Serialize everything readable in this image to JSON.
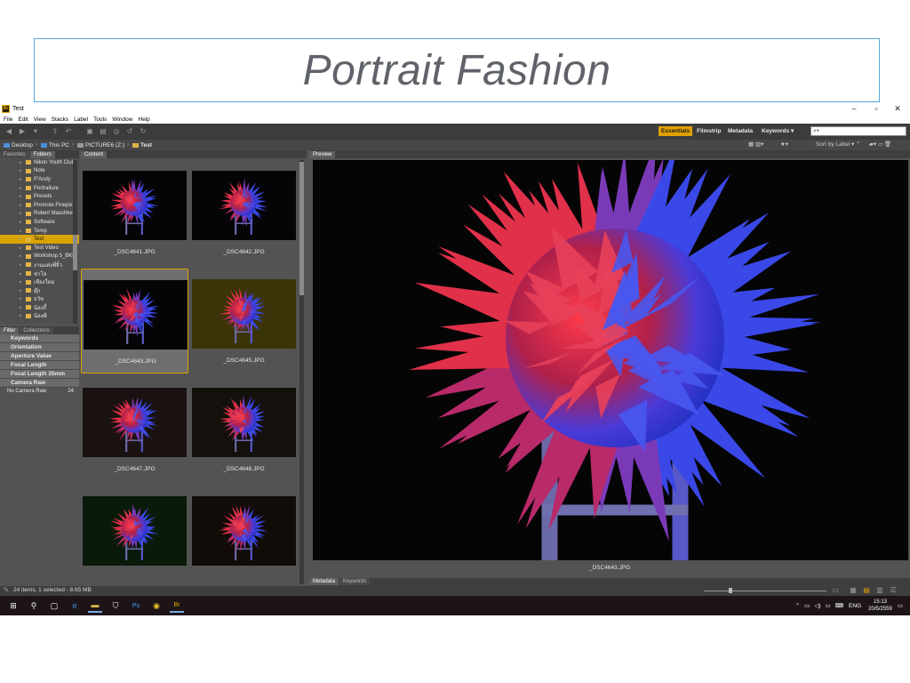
{
  "slide": {
    "title": "Portrait Fashion"
  },
  "window": {
    "title": "Test",
    "app_icon_text": "Br",
    "controls": {
      "minimize": "–",
      "maximize": "▫",
      "close": "✕"
    }
  },
  "menu": [
    "File",
    "Edit",
    "View",
    "Stacks",
    "Label",
    "Tools",
    "Window",
    "Help"
  ],
  "workspaces": {
    "items": [
      "Essentials",
      "Filmstrip",
      "Metadata",
      "Keywords"
    ],
    "active": "Essentials",
    "keywords_arrow": "▾",
    "search_placeholder": "⌕▾"
  },
  "path": {
    "crumbs": [
      "Desktop",
      "This PC",
      "PICTURE6 (Z:)",
      "Test"
    ],
    "sort_label": "Sort by Label"
  },
  "left_panel": {
    "tabs": [
      "Favorites",
      "Folders"
    ],
    "active_tab": "Folders",
    "folders": [
      "Nikon Youth Club",
      "Note",
      "P'Andy",
      "Portraiture",
      "Presets",
      "Promote Finepix",
      "Robert Maschke",
      "Software",
      "Temp",
      "Test",
      "Test Video",
      "Workshop 5_BKK",
      "งานแต่งพี่จิ๋ว",
      "ชาโล",
      "เชียงใหม่",
      "ตุ๊ก",
      "ธวัช",
      "น้องกี้",
      "น้องพี่"
    ],
    "selected_folder": "Test",
    "filter_tabs": [
      "Filter",
      "Collections"
    ],
    "filters": [
      "Keywords",
      "Orientation",
      "Aperture Value",
      "Focal Length",
      "Focal Length 35mm",
      "Camera Raw"
    ],
    "camera_raw_item": {
      "label": "No Camera Raw",
      "count": "24"
    }
  },
  "content_panel": {
    "tab": "Content",
    "thumbnails": [
      {
        "name": "_DSC4641.JPG",
        "bg": "#050508"
      },
      {
        "name": "_DSC4642.JPG",
        "bg": "#050508"
      },
      {
        "name": "_DSC4643.JPG",
        "bg": "#050508"
      },
      {
        "name": "_DSC4645.JPG",
        "bg": "#3a3408"
      },
      {
        "name": "_DSC4647.JPG",
        "bg": "#1a1210"
      },
      {
        "name": "_DSC4648.JPG",
        "bg": "#14100c"
      },
      {
        "name": "",
        "bg": "#0a1a0a"
      },
      {
        "name": "",
        "bg": "#120c08"
      }
    ],
    "selected_index": 2
  },
  "preview_panel": {
    "tab": "Preview",
    "filename": "_DSC4643.JPG"
  },
  "bottom_tabs": [
    "Metadata",
    "Keywords"
  ],
  "status": {
    "text": "24 items, 1 selected - 8.65 MB"
  },
  "taskbar": {
    "language": "ENG",
    "time": "15:13",
    "date": "20/5/2559"
  },
  "colors": {
    "accent": "#e0a000",
    "title_border": "#5aa7d8",
    "title_text": "#5f6369"
  }
}
